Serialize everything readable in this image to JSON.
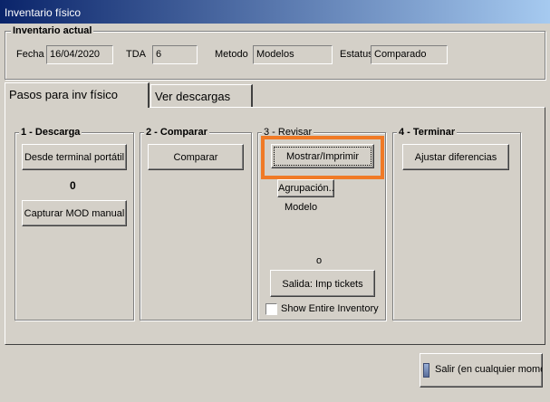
{
  "window": {
    "title": "Inventario físico"
  },
  "inventario_actual": {
    "title": "Inventario actual",
    "fecha": {
      "label": "Fecha",
      "value": "16/04/2020"
    },
    "tda": {
      "label": "TDA",
      "value": "6"
    },
    "metodo": {
      "label": "Metodo",
      "value": "Modelos"
    },
    "estatus": {
      "label": "Estatus",
      "value": "Comparado"
    }
  },
  "tabs": [
    {
      "label": "Pasos para inv físico",
      "active": true
    },
    {
      "label": "Ver descargas",
      "active": false
    }
  ],
  "steps": {
    "descarga": {
      "title": "1 - Descarga",
      "desde_terminal_label": "Desde terminal portátil",
      "count": "0",
      "capturar_label": "Capturar MOD manual"
    },
    "comparar": {
      "title": "2 - Comparar",
      "comparar_label": "Comparar"
    },
    "revisar": {
      "title": "3 - Revisar",
      "mostrar_label": "Mostrar/Imprimir",
      "agrupacion_label": "Agrupación..",
      "agrupacion_value": "Modelo",
      "count": "o",
      "salida_label": "Salida: Imp tickets",
      "show_entire_label": "Show Entire Inventory",
      "show_entire_checked": false
    },
    "terminar": {
      "title": "4 - Terminar",
      "ajustar_label": "Ajustar diferencias"
    }
  },
  "footer": {
    "salir_label": "Salir (en cualquier momento)"
  },
  "colors": {
    "highlight": "#f07a26",
    "title_gradient_start": "#0a246a",
    "title_gradient_end": "#a6caf0"
  },
  "icons": {
    "salir": "exit-door-icon"
  }
}
